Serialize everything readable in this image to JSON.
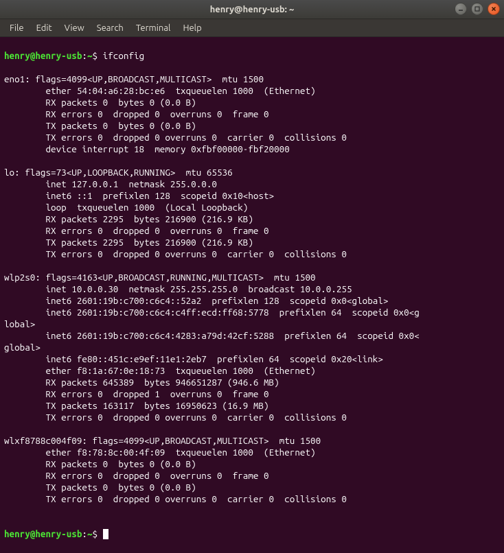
{
  "window": {
    "title": "henry@henry-usb: ~"
  },
  "menubar": {
    "items": [
      "File",
      "Edit",
      "View",
      "Search",
      "Terminal",
      "Help"
    ]
  },
  "prompt": {
    "user_host": "henry@henry-usb",
    "colon": ":",
    "path": "~",
    "dollar": "$"
  },
  "command": "ifconfig",
  "output_lines": [
    "eno1: flags=4099<UP,BROADCAST,MULTICAST>  mtu 1500",
    "        ether 54:04:a6:28:bc:e6  txqueuelen 1000  (Ethernet)",
    "        RX packets 0  bytes 0 (0.0 B)",
    "        RX errors 0  dropped 0  overruns 0  frame 0",
    "        TX packets 0  bytes 0 (0.0 B)",
    "        TX errors 0  dropped 0 overruns 0  carrier 0  collisions 0",
    "        device interrupt 18  memory 0xfbf00000-fbf20000  ",
    "",
    "lo: flags=73<UP,LOOPBACK,RUNNING>  mtu 65536",
    "        inet 127.0.0.1  netmask 255.0.0.0",
    "        inet6 ::1  prefixlen 128  scopeid 0x10<host>",
    "        loop  txqueuelen 1000  (Local Loopback)",
    "        RX packets 2295  bytes 216900 (216.9 KB)",
    "        RX errors 0  dropped 0  overruns 0  frame 0",
    "        TX packets 2295  bytes 216900 (216.9 KB)",
    "        TX errors 0  dropped 0 overruns 0  carrier 0  collisions 0",
    "",
    "wlp2s0: flags=4163<UP,BROADCAST,RUNNING,MULTICAST>  mtu 1500",
    "        inet 10.0.0.30  netmask 255.255.255.0  broadcast 10.0.0.255",
    "        inet6 2601:19b:c700:c6c4::52a2  prefixlen 128  scopeid 0x0<global>",
    "        inet6 2601:19b:c700:c6c4:c4ff:ecd:ff68:5778  prefixlen 64  scopeid 0x0<g",
    "lobal>",
    "        inet6 2601:19b:c700:c6c4:4283:a79d:42cf:5288  prefixlen 64  scopeid 0x0<",
    "global>",
    "        inet6 fe80::451c:e9ef:11e1:2eb7  prefixlen 64  scopeid 0x20<link>",
    "        ether f8:1a:67:0e:18:73  txqueuelen 1000  (Ethernet)",
    "        RX packets 645389  bytes 946651287 (946.6 MB)",
    "        RX errors 0  dropped 1  overruns 0  frame 0",
    "        TX packets 163117  bytes 16950623 (16.9 MB)",
    "        TX errors 0  dropped 0 overruns 0  carrier 0  collisions 0",
    "",
    "wlxf8788c004f09: flags=4099<UP,BROADCAST,MULTICAST>  mtu 1500",
    "        ether f8:78:8c:00:4f:09  txqueuelen 1000  (Ethernet)",
    "        RX packets 0  bytes 0 (0.0 B)",
    "        RX errors 0  dropped 0  overruns 0  frame 0",
    "        TX packets 0  bytes 0 (0.0 B)",
    "        TX errors 0  dropped 0 overruns 0  carrier 0  collisions 0",
    ""
  ]
}
